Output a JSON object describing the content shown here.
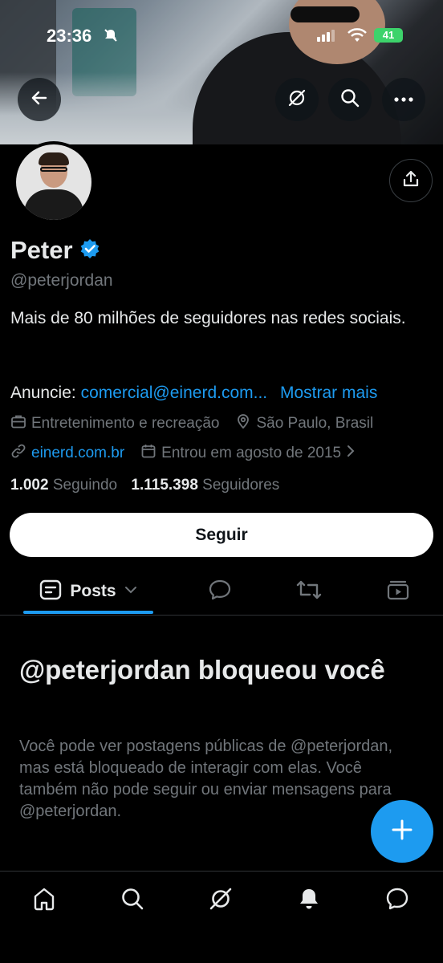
{
  "status_bar": {
    "time": "23:36",
    "battery": "41"
  },
  "profile": {
    "name": "Peter",
    "handle": "@peterjordan",
    "bio": "Mais de 80 milhões de seguidores nas redes sociais.",
    "ad_prefix": "Anuncie:",
    "ad_email": "comercial@einerd.com...",
    "show_more": "Mostrar mais",
    "category": "Entretenimento e recreação",
    "location": "São Paulo, Brasil",
    "website": "einerd.com.br",
    "joined": "Entrou em agosto de 2015",
    "following_count": "1.002",
    "following_label": "Seguindo",
    "followers_count": "1.115.398",
    "followers_label": "Seguidores"
  },
  "follow_button": "Seguir",
  "tabs": {
    "posts_label": "Posts"
  },
  "blocked": {
    "title": "@peterjordan bloqueou você",
    "description": "Você pode ver postagens públicas de @peterjordan, mas está bloqueado de interagir com elas. Você também não pode seguir ou enviar mensagens para @peterjordan."
  },
  "colors": {
    "accent": "#1d9bf0",
    "background": "#000000",
    "secondary_text": "#71767b"
  },
  "icons": {
    "header": [
      "back-arrow-icon",
      "grok-icon",
      "search-icon",
      "more-icon",
      "share-icon"
    ],
    "tabs": [
      "posts-icon",
      "replies-icon",
      "reposts-icon",
      "media-icon"
    ],
    "bottom_nav": [
      "home-icon",
      "explore-icon",
      "grok-icon",
      "notifications-icon",
      "messages-icon"
    ]
  }
}
